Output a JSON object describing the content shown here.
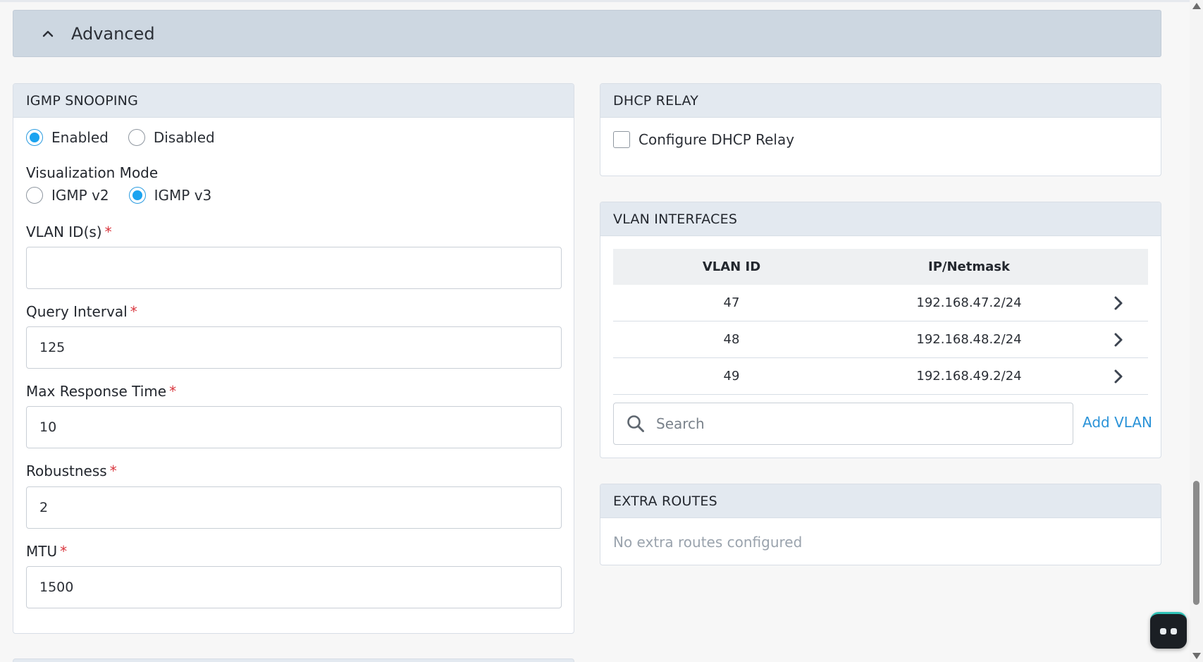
{
  "advanced": {
    "title": "Advanced",
    "icon": "chevron-up-icon"
  },
  "igmp": {
    "header": "IGMP SNOOPING",
    "state_options": [
      {
        "label": "Enabled",
        "selected": true
      },
      {
        "label": "Disabled",
        "selected": false
      }
    ],
    "visualization_mode_label": "Visualization Mode",
    "mode_options": [
      {
        "label": "IGMP v2",
        "selected": false
      },
      {
        "label": "IGMP v3",
        "selected": true
      }
    ],
    "required_marker": "*",
    "vlan_ids": {
      "label": "VLAN ID(s)",
      "value": ""
    },
    "query_interval": {
      "label": "Query Interval",
      "value": "125"
    },
    "max_response_time": {
      "label": "Max Response Time",
      "value": "10"
    },
    "robustness": {
      "label": "Robustness",
      "value": "2"
    },
    "mtu": {
      "label": "MTU",
      "value": "1500"
    }
  },
  "dhcp": {
    "header": "DHCP RELAY",
    "configure_label": "Configure DHCP Relay",
    "configure_checked": false
  },
  "vlan": {
    "header": "VLAN INTERFACES",
    "columns": [
      "VLAN ID",
      "IP/Netmask"
    ],
    "rows": [
      {
        "vlan_id": "47",
        "ip": "192.168.47.2/24"
      },
      {
        "vlan_id": "48",
        "ip": "192.168.48.2/24"
      },
      {
        "vlan_id": "49",
        "ip": "192.168.49.2/24"
      }
    ],
    "search_placeholder": "Search",
    "add_label": "Add VLAN"
  },
  "extra_routes": {
    "header": "EXTRA ROUTES",
    "empty_message": "No extra routes configured"
  },
  "colors": {
    "accent": "#1aa3f0",
    "link": "#2b93d8",
    "required": "#d9363e",
    "header_bg": "#cdd7e1",
    "panel_head_bg": "#e3e9f0"
  }
}
